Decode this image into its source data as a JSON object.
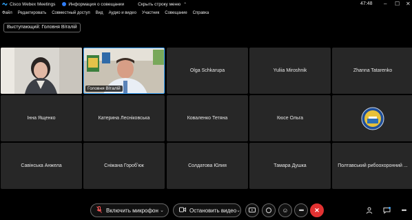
{
  "titlebar": {
    "app_title": "Cisco Webex Meetings",
    "meeting_info_label": "Информация о совещании",
    "hide_menu_label": "Скрыть строку меню",
    "time": "47:48"
  },
  "menu": {
    "items": [
      "Файл",
      "Редактировать",
      "Совместный доступ",
      "Вид",
      "Аудио и видео",
      "Участник",
      "Совещание",
      "Справка"
    ]
  },
  "speaker": {
    "label": "Выступающий: Головня Віталій"
  },
  "tiles": [
    {
      "name": "",
      "video": true,
      "active": false
    },
    {
      "name": "Головня Віталій",
      "video": true,
      "active": true
    },
    {
      "name": "Olga Schkarupa",
      "video": false
    },
    {
      "name": "Yuliia Miroshnik",
      "video": false
    },
    {
      "name": "Zhanna Tatarenko",
      "video": false
    },
    {
      "name": "Інна Ященко",
      "video": false
    },
    {
      "name": "Катерина Лесніковська",
      "video": false
    },
    {
      "name": "Коваленко Тетяна",
      "video": false
    },
    {
      "name": "Кюсе Ольга",
      "video": false
    },
    {
      "name": "",
      "logo": true
    },
    {
      "name": "Савінська Анжела",
      "video": false
    },
    {
      "name": "Сніжана Горобʼюк",
      "video": false
    },
    {
      "name": "Солдатова Юлия",
      "video": false
    },
    {
      "name": "Тамара Душка",
      "video": false
    },
    {
      "name": "Полтавський рибоохоронний ...",
      "video": false
    }
  ],
  "controls": {
    "mic_label": "Включить микрофон",
    "video_label": "Остановить видео"
  },
  "colors": {
    "accent": "#3fa8ff",
    "end_call": "#e23232",
    "tile_bg": "#272727"
  }
}
